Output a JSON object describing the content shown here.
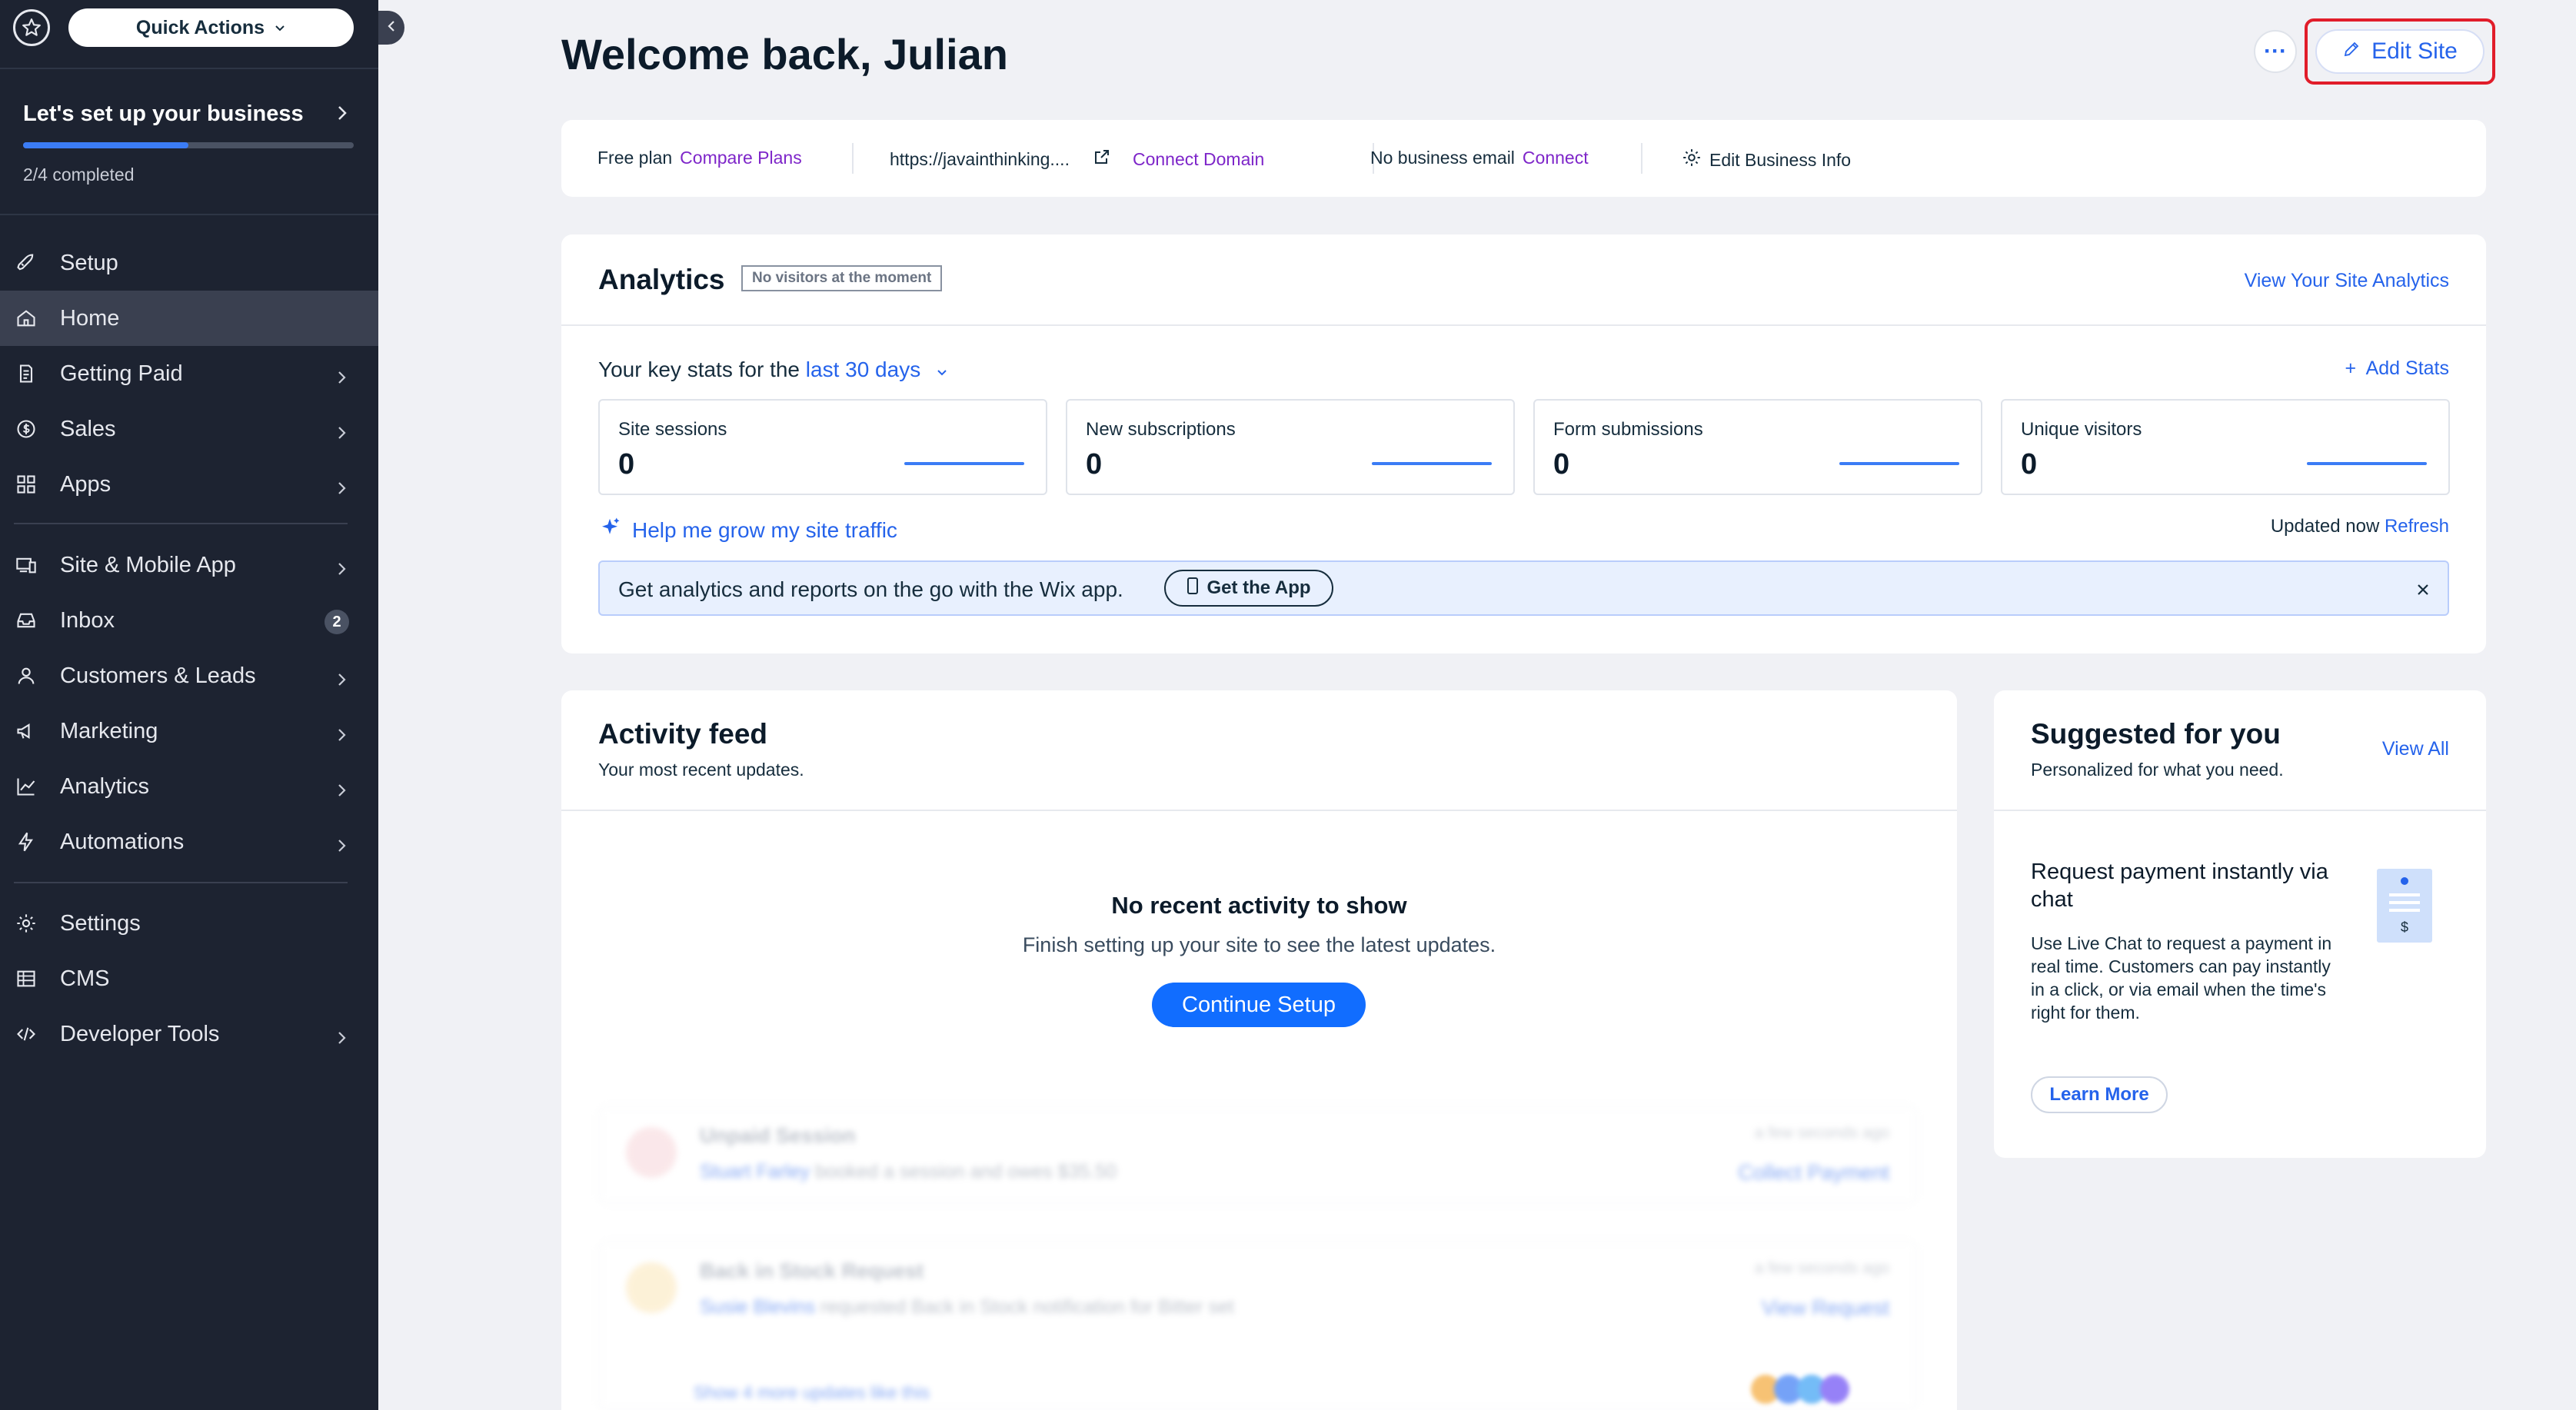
{
  "sidebar": {
    "quick_actions": "Quick Actions",
    "setup": {
      "title": "Let's set up your business",
      "progress_text": "2/4 completed",
      "progress_fraction": 0.5
    },
    "nav": [
      {
        "label": "Setup",
        "icon": "rocket-icon"
      },
      {
        "label": "Home",
        "icon": "home-icon",
        "active": true
      },
      {
        "label": "Getting Paid",
        "icon": "receipt-icon"
      },
      {
        "label": "Sales",
        "icon": "dollar-icon"
      },
      {
        "label": "Apps",
        "icon": "apps-icon"
      },
      {
        "label": "Site & Mobile App",
        "icon": "devices-icon"
      },
      {
        "label": "Inbox",
        "icon": "inbox-icon",
        "badge": "2"
      },
      {
        "label": "Customers & Leads",
        "icon": "users-icon"
      },
      {
        "label": "Marketing",
        "icon": "megaphone-icon"
      },
      {
        "label": "Analytics",
        "icon": "chart-icon"
      },
      {
        "label": "Automations",
        "icon": "bolt-icon"
      },
      {
        "label": "Settings",
        "icon": "gear-icon"
      },
      {
        "label": "CMS",
        "icon": "table-icon"
      },
      {
        "label": "Developer Tools",
        "icon": "code-icon"
      }
    ]
  },
  "header": {
    "welcome": "Welcome back, Julian",
    "more": "···",
    "edit_site": "Edit Site"
  },
  "infobar": {
    "plan": "Free plan",
    "compare": "Compare Plans",
    "url": "https://javainthinking....",
    "connect_domain": "Connect Domain",
    "email": "No business email",
    "connect": "Connect",
    "edit_info": "Edit Business Info"
  },
  "analytics": {
    "title": "Analytics",
    "tag": "No visitors at the moment",
    "view": "View Your Site Analytics",
    "keystats_prefix": "Your key stats for the",
    "keystats_range": "last 30 days",
    "add_stats": "Add Stats",
    "stats": [
      {
        "label": "Site sessions",
        "value": "0"
      },
      {
        "label": "New subscriptions",
        "value": "0"
      },
      {
        "label": "Form submissions",
        "value": "0"
      },
      {
        "label": "Unique visitors",
        "value": "0"
      }
    ],
    "grow": "Help me grow my site traffic",
    "updated": "Updated now",
    "refresh": "Refresh",
    "banner_text": "Get analytics and reports on the go with the Wix app.",
    "get_app": "Get the App"
  },
  "activity": {
    "title": "Activity feed",
    "subtitle": "Your most recent updates.",
    "empty_title": "No recent activity to show",
    "empty_sub": "Finish setting up your site to see the latest updates.",
    "continue": "Continue Setup",
    "ghost": [
      {
        "title": "Unpaid Session",
        "name": "Stuart Farley",
        "desc": "booked a session and owes $35.50",
        "time": "a few seconds ago",
        "action": "Collect Payment"
      },
      {
        "title": "Back in Stock Request",
        "name": "Susie Blevins",
        "desc": "requested Back in Stock notification for Bitter set",
        "time": "a few seconds ago",
        "action": "View Request"
      }
    ],
    "more": "Show 4 more updates like this"
  },
  "suggested": {
    "title": "Suggested for you",
    "subtitle": "Personalized for what you need.",
    "view_all": "View All",
    "card_title": "Request payment instantly via chat",
    "card_desc": "Use Live Chat to request a payment in real time. Customers can pay instantly in a click, or via email when the time's right for them.",
    "learn_more": "Learn More"
  },
  "colors": {
    "accent": "#116dff",
    "link": "#2563eb",
    "purple_link": "#7e26c9",
    "sidebar": "#1d2331",
    "highlight": "#e11d2a"
  }
}
